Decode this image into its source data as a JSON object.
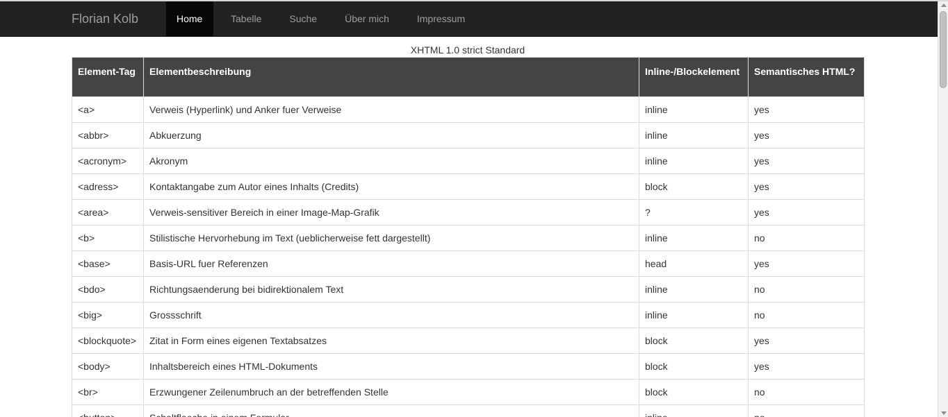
{
  "navbar": {
    "brand": "Florian Kolb",
    "items": [
      {
        "label": "Home",
        "active": true
      },
      {
        "label": "Tabelle",
        "active": false
      },
      {
        "label": "Suche",
        "active": false
      },
      {
        "label": "Über mich",
        "active": false
      },
      {
        "label": "Impressum",
        "active": false
      }
    ]
  },
  "table": {
    "caption": "XHTML 1.0 strict Standard",
    "headers": [
      "Element-Tag",
      "Elementbeschreibung",
      "Inline-/Blockelement",
      "Semantisches HTML?"
    ],
    "rows": [
      [
        "<a>",
        "Verweis (Hyperlink) und Anker fuer Verweise",
        "inline",
        "yes"
      ],
      [
        "<abbr>",
        "Abkuerzung",
        "inline",
        "yes"
      ],
      [
        "<acronym>",
        "Akronym",
        "inline",
        "yes"
      ],
      [
        "<adress>",
        "Kontaktangabe zum Autor eines Inhalts (Credits)",
        "block",
        "yes"
      ],
      [
        "<area>",
        "Verweis-sensitiver Bereich in einer Image-Map-Grafik",
        "?",
        "yes"
      ],
      [
        "<b>",
        "Stilistische Hervorhebung im Text (ueblicherweise fett dargestellt)",
        "inline",
        "no"
      ],
      [
        "<base>",
        "Basis-URL fuer Referenzen",
        "head",
        "yes"
      ],
      [
        "<bdo>",
        "Richtungsaenderung bei bidirektionalem Text",
        "inline",
        "no"
      ],
      [
        "<big>",
        "Grossschrift",
        "inline",
        "no"
      ],
      [
        "<blockquote>",
        "Zitat in Form eines eigenen Textabsatzes",
        "block",
        "yes"
      ],
      [
        "<body>",
        "Inhaltsbereich eines HTML-Dokuments",
        "block",
        "yes"
      ],
      [
        "<br>",
        "Erzwungener Zeilenumbruch an der betreffenden Stelle",
        "block",
        "no"
      ],
      [
        "<button>",
        "Schaltflaeche in einem Formular",
        "inline",
        "no"
      ]
    ]
  },
  "colors": {
    "navbar_bg": "#222222",
    "nav_active_bg": "#080808",
    "table_header_bg": "#444444",
    "border": "#dddddd"
  }
}
